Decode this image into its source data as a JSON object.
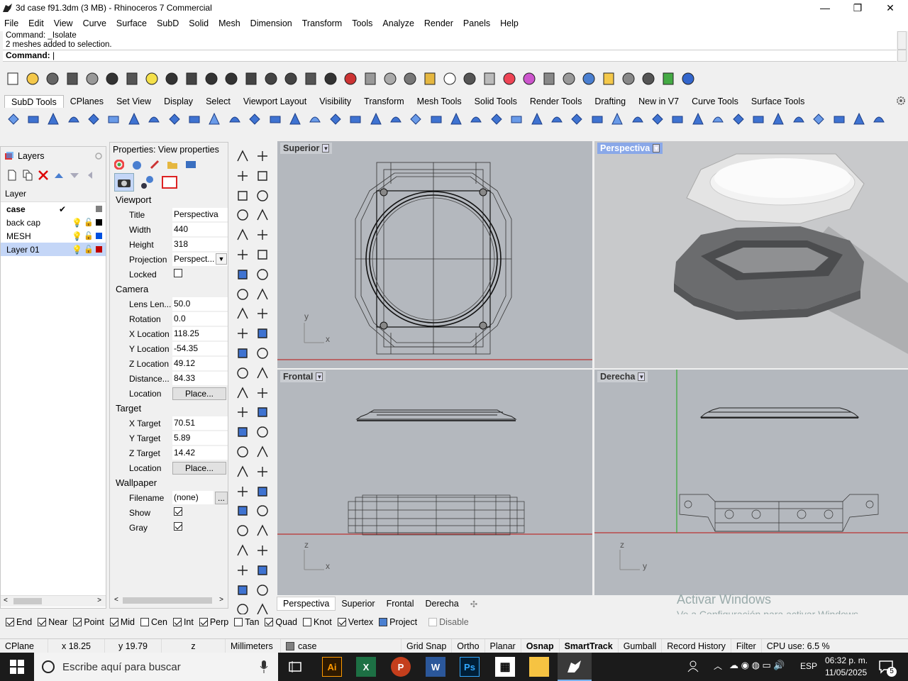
{
  "window": {
    "title": "3d case f91.3dm (3 MB) - Rhinoceros 7 Commercial",
    "minimize": "—",
    "restore": "❐",
    "close": "✕"
  },
  "menu": [
    "File",
    "Edit",
    "View",
    "Curve",
    "Surface",
    "SubD",
    "Solid",
    "Mesh",
    "Dimension",
    "Transform",
    "Tools",
    "Analyze",
    "Render",
    "Panels",
    "Help"
  ],
  "command": {
    "history1": "Command: _Isolate",
    "history2": "2 meshes added to selection.",
    "prompt": "Command:"
  },
  "toolbar_tabs": [
    "SubD Tools",
    "CPlanes",
    "Set View",
    "Display",
    "Select",
    "Viewport Layout",
    "Visibility",
    "Transform",
    "Mesh Tools",
    "Solid Tools",
    "Render Tools",
    "Drafting",
    "New in V7",
    "Curve Tools",
    "Surface Tools"
  ],
  "layers": {
    "title": "Layers",
    "column": "Layer",
    "rows": [
      {
        "name": "case",
        "current": true,
        "color": "#808080"
      },
      {
        "name": "back cap",
        "current": false,
        "color": "#000000"
      },
      {
        "name": "MESH",
        "current": false,
        "color": "#0050e0"
      },
      {
        "name": "Layer 01",
        "current": false,
        "color": "#c00000",
        "selected": true
      }
    ]
  },
  "properties": {
    "title": "Properties: View properties",
    "viewport_section": "Viewport",
    "title_label": "Title",
    "title_value": "Perspectiva",
    "width_label": "Width",
    "width_value": "440",
    "height_label": "Height",
    "height_value": "318",
    "projection_label": "Projection",
    "projection_value": "Perspect...",
    "locked_label": "Locked",
    "camera_section": "Camera",
    "lens_label": "Lens Len...",
    "lens_value": "50.0",
    "rotation_label": "Rotation",
    "rotation_value": "0.0",
    "xloc_label": "X Location",
    "xloc_value": "118.25",
    "yloc_label": "Y Location",
    "yloc_value": "-54.35",
    "zloc_label": "Z Location",
    "zloc_value": "49.12",
    "dist_label": "Distance...",
    "dist_value": "84.33",
    "location_label": "Location",
    "place_button": "Place...",
    "target_section": "Target",
    "xt_label": "X Target",
    "xt_value": "70.51",
    "yt_label": "Y Target",
    "yt_value": "5.89",
    "zt_label": "Z Target",
    "zt_value": "14.42",
    "tloc_label": "Location",
    "tplace_button": "Place...",
    "wallpaper_section": "Wallpaper",
    "filename_label": "Filename",
    "filename_value": "(none)",
    "browse_button": "...",
    "show_label": "Show",
    "gray_label": "Gray"
  },
  "viewports": {
    "top": "Superior",
    "persp": "Perspectiva",
    "front": "Frontal",
    "right": "Derecha",
    "axis_x": "x",
    "axis_y": "y",
    "axis_z": "z"
  },
  "viewport_tabs": [
    "Perspectiva",
    "Superior",
    "Frontal",
    "Derecha"
  ],
  "watermark": {
    "line1": "Activar Windows",
    "line2": "Ve a Configuración para activar Windows."
  },
  "osnaps": [
    {
      "label": "End",
      "on": true
    },
    {
      "label": "Near",
      "on": true
    },
    {
      "label": "Point",
      "on": true
    },
    {
      "label": "Mid",
      "on": true
    },
    {
      "label": "Cen",
      "on": false
    },
    {
      "label": "Int",
      "on": true
    },
    {
      "label": "Perp",
      "on": true
    },
    {
      "label": "Tan",
      "on": false
    },
    {
      "label": "Quad",
      "on": true
    },
    {
      "label": "Knot",
      "on": false
    },
    {
      "label": "Vertex",
      "on": true
    },
    {
      "label": "Project",
      "on": false
    },
    {
      "label": "Disable",
      "on": false
    }
  ],
  "status": {
    "cplane": "CPlane",
    "x": "x 18.25",
    "y": "y 19.79",
    "z": "z",
    "units": "Millimeters",
    "layer": "case",
    "grid_snap": "Grid Snap",
    "ortho": "Ortho",
    "planar": "Planar",
    "osnap": "Osnap",
    "smarttrack": "SmartTrack",
    "gumball": "Gumball",
    "record_history": "Record History",
    "filter": "Filter",
    "cpu": "CPU use: 6.5 %"
  },
  "taskbar": {
    "search_placeholder": "Escribe aquí para buscar",
    "lang": "ESP",
    "time": "06:32 p. m.",
    "date": "11/05/2025",
    "notif": "5"
  }
}
